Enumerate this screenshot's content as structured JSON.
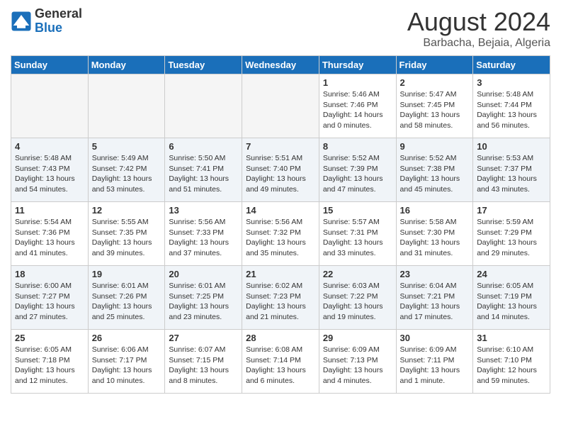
{
  "header": {
    "logo_line1": "General",
    "logo_line2": "Blue",
    "month_year": "August 2024",
    "location": "Barbacha, Bejaia, Algeria"
  },
  "days_of_week": [
    "Sunday",
    "Monday",
    "Tuesday",
    "Wednesday",
    "Thursday",
    "Friday",
    "Saturday"
  ],
  "weeks": [
    {
      "alt": false,
      "days": [
        {
          "num": "",
          "info": ""
        },
        {
          "num": "",
          "info": ""
        },
        {
          "num": "",
          "info": ""
        },
        {
          "num": "",
          "info": ""
        },
        {
          "num": "1",
          "info": "Sunrise: 5:46 AM\nSunset: 7:46 PM\nDaylight: 14 hours\nand 0 minutes."
        },
        {
          "num": "2",
          "info": "Sunrise: 5:47 AM\nSunset: 7:45 PM\nDaylight: 13 hours\nand 58 minutes."
        },
        {
          "num": "3",
          "info": "Sunrise: 5:48 AM\nSunset: 7:44 PM\nDaylight: 13 hours\nand 56 minutes."
        }
      ]
    },
    {
      "alt": true,
      "days": [
        {
          "num": "4",
          "info": "Sunrise: 5:48 AM\nSunset: 7:43 PM\nDaylight: 13 hours\nand 54 minutes."
        },
        {
          "num": "5",
          "info": "Sunrise: 5:49 AM\nSunset: 7:42 PM\nDaylight: 13 hours\nand 53 minutes."
        },
        {
          "num": "6",
          "info": "Sunrise: 5:50 AM\nSunset: 7:41 PM\nDaylight: 13 hours\nand 51 minutes."
        },
        {
          "num": "7",
          "info": "Sunrise: 5:51 AM\nSunset: 7:40 PM\nDaylight: 13 hours\nand 49 minutes."
        },
        {
          "num": "8",
          "info": "Sunrise: 5:52 AM\nSunset: 7:39 PM\nDaylight: 13 hours\nand 47 minutes."
        },
        {
          "num": "9",
          "info": "Sunrise: 5:52 AM\nSunset: 7:38 PM\nDaylight: 13 hours\nand 45 minutes."
        },
        {
          "num": "10",
          "info": "Sunrise: 5:53 AM\nSunset: 7:37 PM\nDaylight: 13 hours\nand 43 minutes."
        }
      ]
    },
    {
      "alt": false,
      "days": [
        {
          "num": "11",
          "info": "Sunrise: 5:54 AM\nSunset: 7:36 PM\nDaylight: 13 hours\nand 41 minutes."
        },
        {
          "num": "12",
          "info": "Sunrise: 5:55 AM\nSunset: 7:35 PM\nDaylight: 13 hours\nand 39 minutes."
        },
        {
          "num": "13",
          "info": "Sunrise: 5:56 AM\nSunset: 7:33 PM\nDaylight: 13 hours\nand 37 minutes."
        },
        {
          "num": "14",
          "info": "Sunrise: 5:56 AM\nSunset: 7:32 PM\nDaylight: 13 hours\nand 35 minutes."
        },
        {
          "num": "15",
          "info": "Sunrise: 5:57 AM\nSunset: 7:31 PM\nDaylight: 13 hours\nand 33 minutes."
        },
        {
          "num": "16",
          "info": "Sunrise: 5:58 AM\nSunset: 7:30 PM\nDaylight: 13 hours\nand 31 minutes."
        },
        {
          "num": "17",
          "info": "Sunrise: 5:59 AM\nSunset: 7:29 PM\nDaylight: 13 hours\nand 29 minutes."
        }
      ]
    },
    {
      "alt": true,
      "days": [
        {
          "num": "18",
          "info": "Sunrise: 6:00 AM\nSunset: 7:27 PM\nDaylight: 13 hours\nand 27 minutes."
        },
        {
          "num": "19",
          "info": "Sunrise: 6:01 AM\nSunset: 7:26 PM\nDaylight: 13 hours\nand 25 minutes."
        },
        {
          "num": "20",
          "info": "Sunrise: 6:01 AM\nSunset: 7:25 PM\nDaylight: 13 hours\nand 23 minutes."
        },
        {
          "num": "21",
          "info": "Sunrise: 6:02 AM\nSunset: 7:23 PM\nDaylight: 13 hours\nand 21 minutes."
        },
        {
          "num": "22",
          "info": "Sunrise: 6:03 AM\nSunset: 7:22 PM\nDaylight: 13 hours\nand 19 minutes."
        },
        {
          "num": "23",
          "info": "Sunrise: 6:04 AM\nSunset: 7:21 PM\nDaylight: 13 hours\nand 17 minutes."
        },
        {
          "num": "24",
          "info": "Sunrise: 6:05 AM\nSunset: 7:19 PM\nDaylight: 13 hours\nand 14 minutes."
        }
      ]
    },
    {
      "alt": false,
      "days": [
        {
          "num": "25",
          "info": "Sunrise: 6:05 AM\nSunset: 7:18 PM\nDaylight: 13 hours\nand 12 minutes."
        },
        {
          "num": "26",
          "info": "Sunrise: 6:06 AM\nSunset: 7:17 PM\nDaylight: 13 hours\nand 10 minutes."
        },
        {
          "num": "27",
          "info": "Sunrise: 6:07 AM\nSunset: 7:15 PM\nDaylight: 13 hours\nand 8 minutes."
        },
        {
          "num": "28",
          "info": "Sunrise: 6:08 AM\nSunset: 7:14 PM\nDaylight: 13 hours\nand 6 minutes."
        },
        {
          "num": "29",
          "info": "Sunrise: 6:09 AM\nSunset: 7:13 PM\nDaylight: 13 hours\nand 4 minutes."
        },
        {
          "num": "30",
          "info": "Sunrise: 6:09 AM\nSunset: 7:11 PM\nDaylight: 13 hours\nand 1 minute."
        },
        {
          "num": "31",
          "info": "Sunrise: 6:10 AM\nSunset: 7:10 PM\nDaylight: 12 hours\nand 59 minutes."
        }
      ]
    }
  ]
}
